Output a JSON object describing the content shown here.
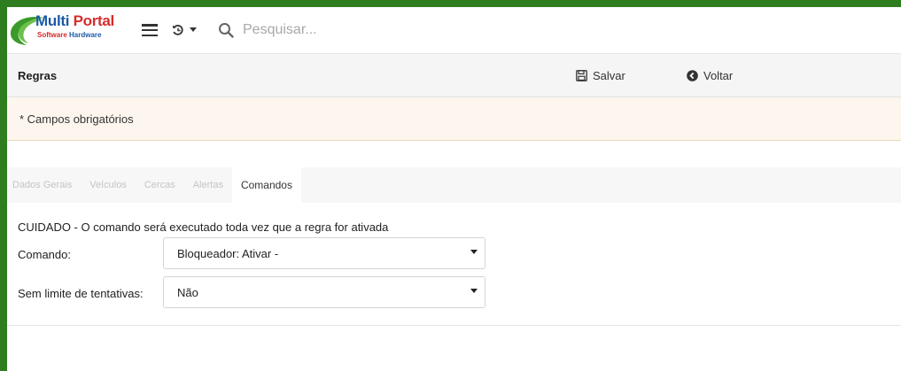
{
  "app": {
    "logo_main": "Multi",
    "logo_portal": "Portal",
    "logo_sub1": "Software",
    "logo_sub2": "Hardware",
    "search_placeholder": "Pesquisar..."
  },
  "header": {
    "title": "Regras",
    "save_label": "Salvar",
    "back_label": "Voltar"
  },
  "notice": {
    "text": "* Campos obrigatórios"
  },
  "tabs": [
    {
      "label": "Dados Gerais",
      "active": false
    },
    {
      "label": "Veículos",
      "active": false
    },
    {
      "label": "Cercas",
      "active": false
    },
    {
      "label": "Alertas",
      "active": false
    },
    {
      "label": "Comandos",
      "active": true
    }
  ],
  "form": {
    "warning": "CUIDADO - O comando será executado toda vez que a regra for ativada",
    "command_label": "Comando:",
    "command_value": "Bloqueador: Ativar -",
    "unlimited_label": "Sem limite de tentativas:",
    "unlimited_value": "Não"
  },
  "colors": {
    "frame_border": "#2e7d1f",
    "logo_blue": "#1c5aa8",
    "logo_red": "#d62b2b",
    "logo_green": "#3a9a2a",
    "notice_bg": "#fcf6ee"
  },
  "icons": [
    "menu-icon",
    "history-icon",
    "caret-down-icon",
    "search-icon",
    "save-icon",
    "back-icon"
  ]
}
